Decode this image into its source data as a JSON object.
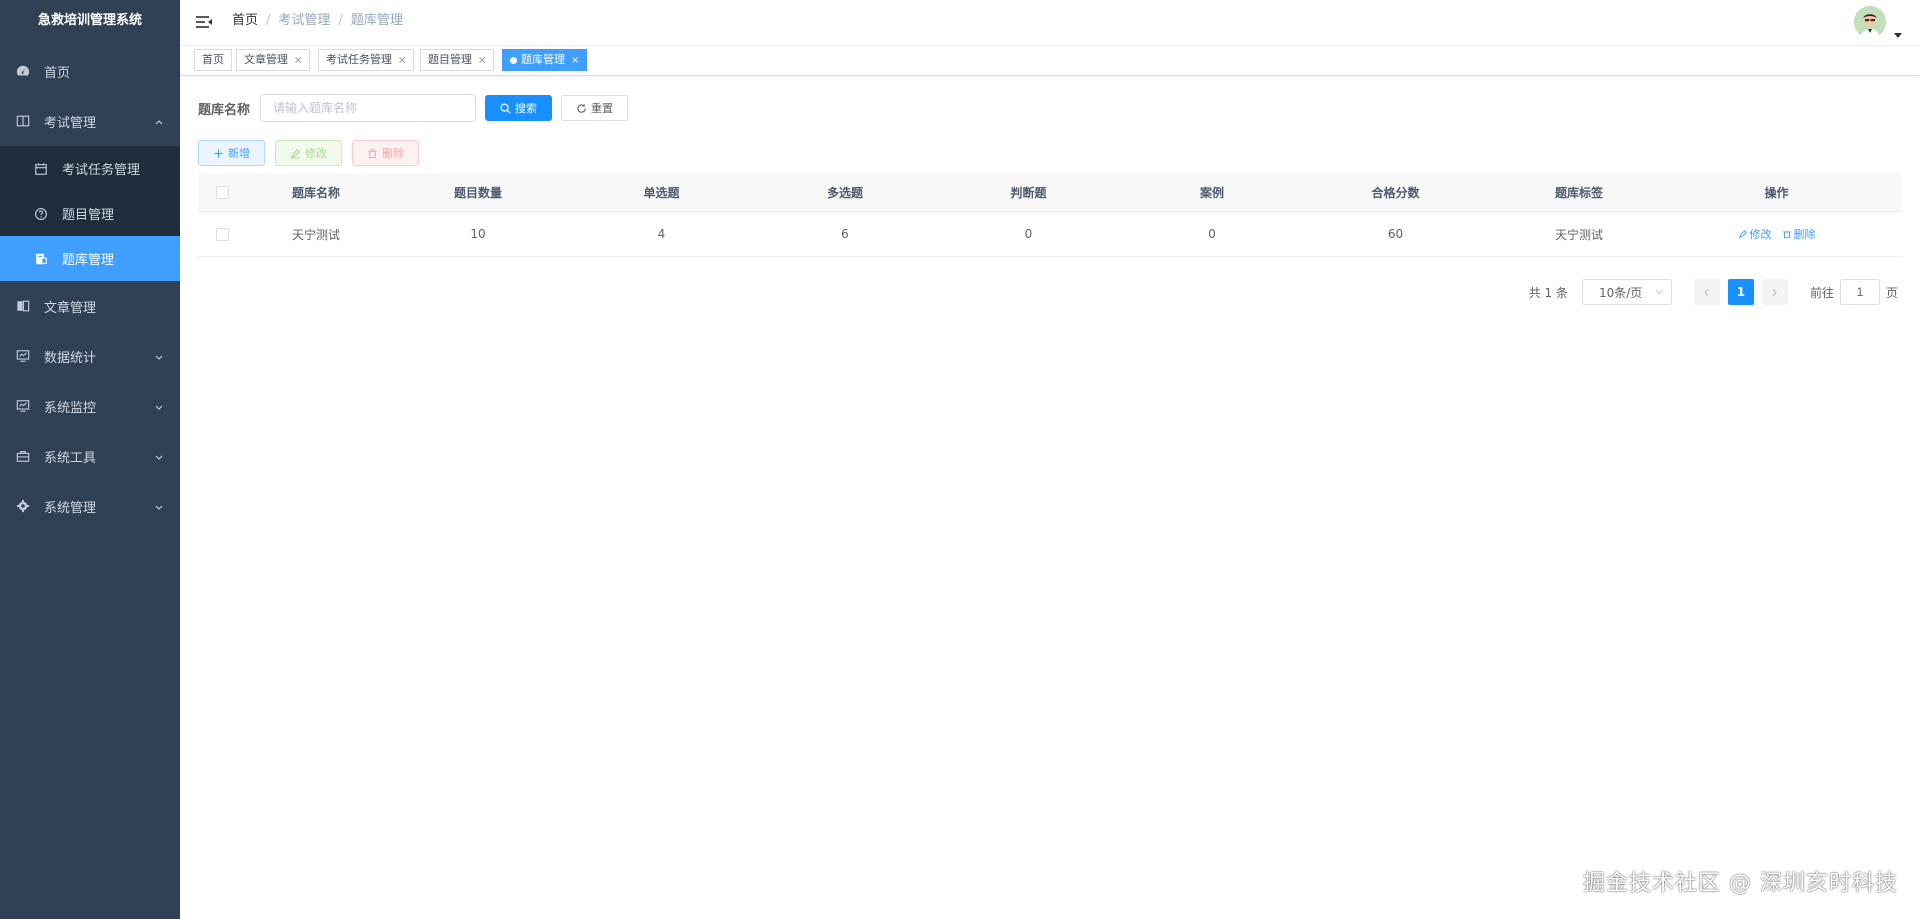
{
  "sidebar": {
    "logo": "急救培训管理系统",
    "items": [
      {
        "label": "首页",
        "icon": "dashboard-icon"
      },
      {
        "label": "考试管理",
        "icon": "book-icon",
        "expanded": true,
        "children": [
          {
            "label": "考试任务管理",
            "icon": "calendar-icon"
          },
          {
            "label": "题目管理",
            "icon": "question-icon"
          },
          {
            "label": "题库管理",
            "icon": "document-icon",
            "active": true
          }
        ]
      },
      {
        "label": "文章管理",
        "icon": "article-icon"
      },
      {
        "label": "数据统计",
        "icon": "monitor-icon"
      },
      {
        "label": "系统监控",
        "icon": "monitor-icon"
      },
      {
        "label": "系统工具",
        "icon": "toolbox-icon"
      },
      {
        "label": "系统管理",
        "icon": "gear-icon"
      }
    ]
  },
  "navbar": {
    "breadcrumb": [
      "首页",
      "考试管理",
      "题库管理"
    ]
  },
  "tags": [
    {
      "label": "首页"
    },
    {
      "label": "文章管理",
      "closable": "×"
    },
    {
      "label": "考试任务管理",
      "closable": "×"
    },
    {
      "label": "题目管理",
      "closable": "×"
    },
    {
      "label": "题库管理",
      "closable": "×",
      "active": true
    }
  ],
  "search": {
    "label": "题库名称",
    "placeholder": "请输入题库名称",
    "value": "",
    "search_button": "搜索",
    "reset_button": "重置"
  },
  "toolbar": {
    "add_label": "新增",
    "edit_label": "修改",
    "delete_label": "删除"
  },
  "table": {
    "columns": [
      "题库名称",
      "题目数量",
      "单选题",
      "多选题",
      "判断题",
      "案例",
      "合格分数",
      "题库标签",
      "操作"
    ],
    "rows": [
      {
        "name": "天宁测试",
        "count": "10",
        "single": "4",
        "multi": "6",
        "judge": "0",
        "case": "0",
        "pass": "60",
        "tag": "天宁测试",
        "edit": "修改",
        "delete": "删除"
      }
    ]
  },
  "pagination": {
    "total": "共 1 条",
    "page_size": "10条/页",
    "current_page": "1",
    "goto_label": "前往",
    "goto_value": "1",
    "page_suffix": "页"
  },
  "watermark": "掘金技术社区 @ 深圳亥时科技",
  "colors": {
    "sidebar_bg": "#304156",
    "sidebar_active": "#409eff",
    "primary": "#1890ff"
  }
}
